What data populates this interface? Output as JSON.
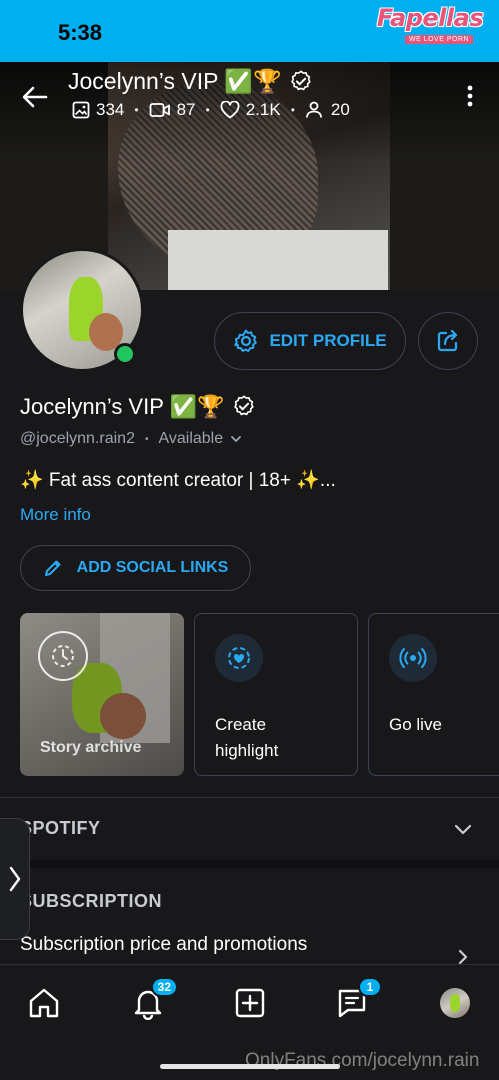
{
  "status_bar": {
    "time": "5:38"
  },
  "watermark": {
    "brand": "Fapellas",
    "tagline": "WE LOVE PORN",
    "url": "OnlyFans.com/jocelynn.rain"
  },
  "header": {
    "name": "Jocelynn’s VIP ✅🏆",
    "stats": {
      "images": "334",
      "videos": "87",
      "likes": "2.1K",
      "subscribers": "20"
    }
  },
  "profile": {
    "edit_label": "EDIT PROFILE",
    "name": "Jocelynn’s VIP ✅🏆",
    "handle": "@jocelynn.rain2",
    "availability": "Available",
    "bio": "✨ Fat ass content creator | 18+ ✨...",
    "more_info": "More info",
    "social_label": "ADD SOCIAL LINKS"
  },
  "cards": {
    "story_archive": "Story archive",
    "create_highlight": [
      "Create",
      "highlight"
    ],
    "go_live": "Go live"
  },
  "sections": {
    "spotify": "SPOTIFY",
    "subscription": "SUBSCRIPTION",
    "subscription_text": "Subscription price and promotions"
  },
  "nav": {
    "notifications_badge": "32",
    "messages_badge": "1"
  },
  "colors": {
    "accent": "#00aff0",
    "link": "#2aa9f2",
    "online": "#22c55e",
    "background": "#18181b"
  }
}
